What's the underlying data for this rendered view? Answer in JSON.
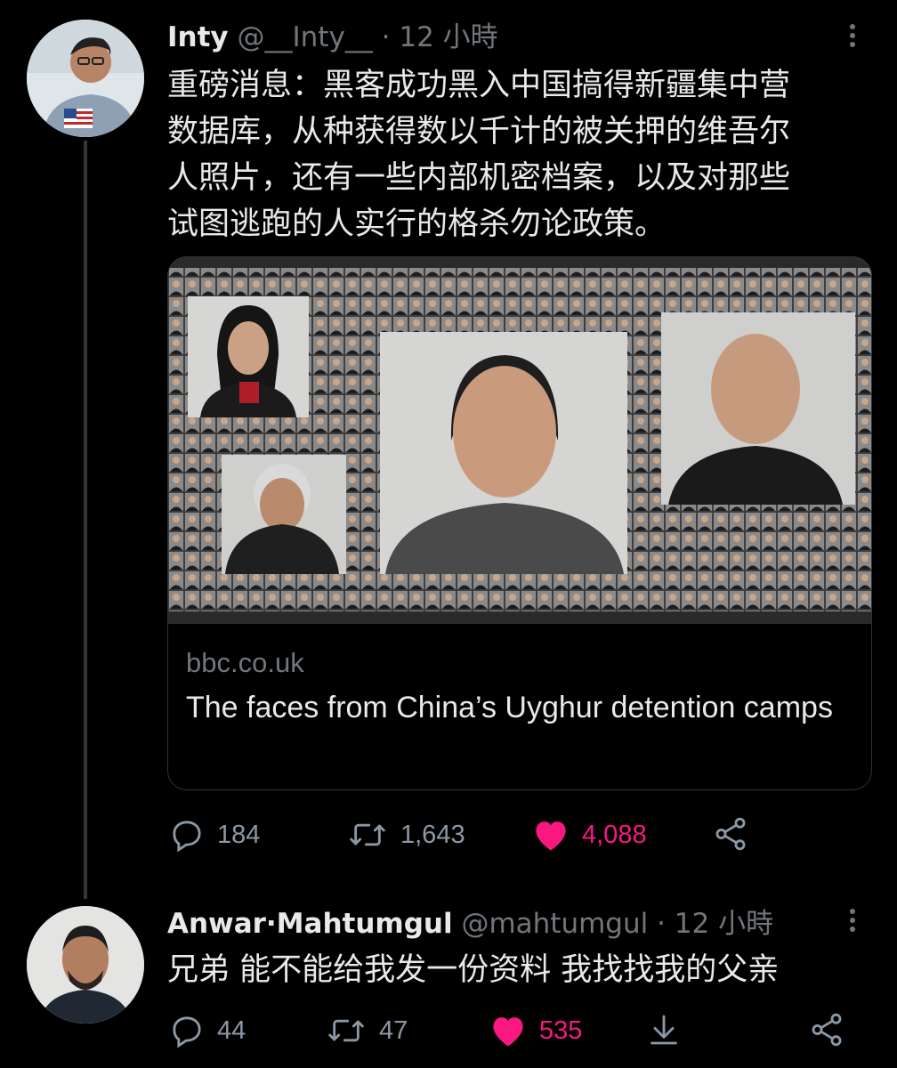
{
  "tweet1": {
    "display_name": "Inty",
    "handle": "@__Inty__",
    "separator": "·",
    "timestamp": "12 小時",
    "text_lines": [
      "重磅消息：黑客成功黑入中国搞得新疆集中营",
      "数据库，从种获得数以千计的被关押的维吾尔",
      "人照片，还有一些内部机密档案，以及对那些",
      "试图逃跑的人实行的格杀勿论政策。"
    ],
    "card": {
      "domain": "bbc.co.uk",
      "title": "The faces from China’s Uyghur detention camps"
    },
    "actions": {
      "replies": "184",
      "retweets": "1,643",
      "likes": "4,088"
    }
  },
  "tweet2": {
    "display_name": "Anwar·Mahtumgul",
    "handle": "@mahtumgul",
    "separator": "·",
    "timestamp": "12 小時",
    "text": "兄弟 能不能给我发一份资料 我找找我的父亲",
    "actions": {
      "replies": "44",
      "retweets": "47",
      "likes": "535"
    }
  },
  "colors": {
    "background": "#000000",
    "text": "#e7e9ea",
    "muted": "#71767b",
    "like_pink": "#f91880",
    "border": "#2f3336"
  },
  "icons": [
    "reply-icon",
    "retweet-icon",
    "heart-icon",
    "share-icon",
    "download-icon",
    "more-icon"
  ]
}
